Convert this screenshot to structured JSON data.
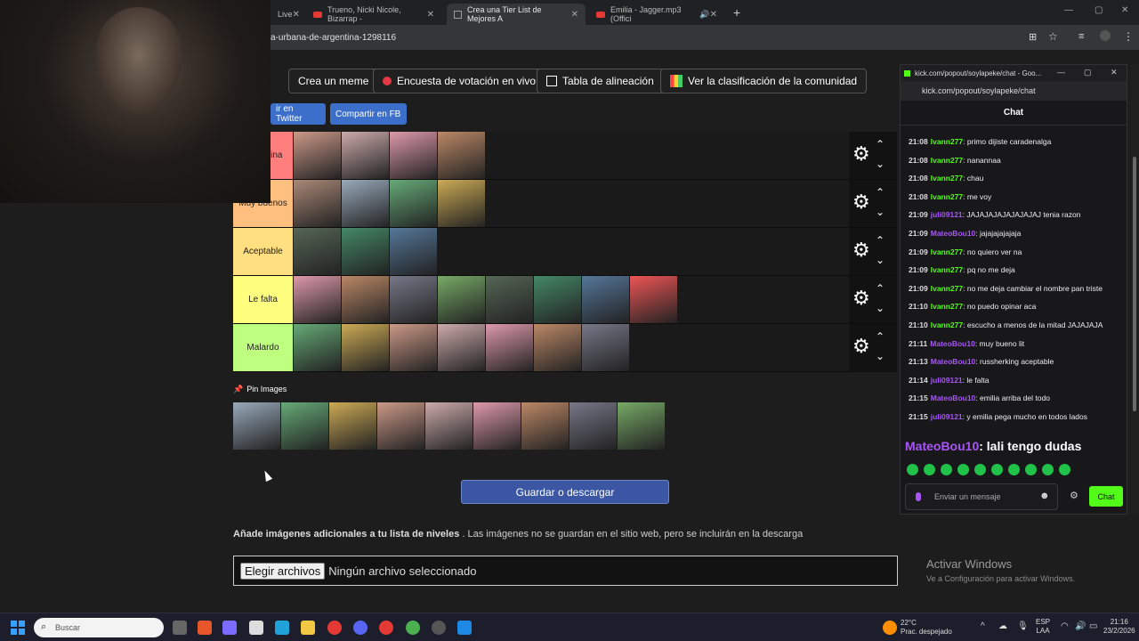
{
  "browser": {
    "tabs": [
      {
        "title": "Live"
      },
      {
        "title": "Trueno, Nicki Nicole, Bizarrap -"
      },
      {
        "title": "Crea una Tier List de Mejores A"
      },
      {
        "title": "Emilia - Jagger.mp3 (Offici"
      }
    ],
    "url": "a-urbana-de-argentina-1298116"
  },
  "toolbar": {
    "meme": "Crea un meme",
    "poll": "Encuesta de votación en vivo",
    "align": "Tabla de alineación",
    "ranking": "Ver la clasificación de la comunidad"
  },
  "share": {
    "twitter": "ir en Twitter",
    "fb": "Compartir en FB"
  },
  "tiers": [
    {
      "label": "ores\nntina",
      "color": "#ff7f7f",
      "count": 4
    },
    {
      "label": "Muy buenos",
      "color": "#ffbf7f",
      "count": 4
    },
    {
      "label": "Aceptable",
      "color": "#ffdf7f",
      "count": 3
    },
    {
      "label": "Le falta",
      "color": "#ffff7f",
      "count": 8
    },
    {
      "label": "Malardo",
      "color": "#bfff7f",
      "count": 7
    }
  ],
  "pin": {
    "label": "Pin Images",
    "count": 9
  },
  "save_button": "Guardar o descargar",
  "add_images": {
    "title": "Añade imágenes adicionales a tu lista de niveles",
    "note": ". Las imágenes no se guardan en el sitio web, pero se incluirán en la descarga"
  },
  "file": {
    "button": "Elegir archivos",
    "status": "Ningún archivo seleccionado"
  },
  "windows_activation": {
    "title": "Activar Windows",
    "subtitle": "Ve a Configuración para activar Windows."
  },
  "chat_popup": {
    "window_title": "kick.com/popout/soylapeke/chat - Goo...",
    "url": "kick.com/popout/soylapeke/chat",
    "header": "Chat",
    "messages": [
      {
        "time": "21:08",
        "user": "Ivann277",
        "text": ": primo dijiste caradenalga",
        "color": "#53fc18"
      },
      {
        "time": "21:08",
        "user": "Ivann277",
        "text": ": nanannaa",
        "color": "#53fc18"
      },
      {
        "time": "21:08",
        "user": "Ivann277",
        "text": ": chau",
        "color": "#53fc18"
      },
      {
        "time": "21:08",
        "user": "Ivann277",
        "text": ": me voy",
        "color": "#53fc18"
      },
      {
        "time": "21:09",
        "user": "juli09121",
        "text": ": JAJAJAJAJAJAJAJAJ tenia razon",
        "color": "#a855f7"
      },
      {
        "time": "21:09",
        "user": "MateoBou10",
        "text": ": jajajajajajaja",
        "color": "#a855f7"
      },
      {
        "time": "21:09",
        "user": "Ivann277",
        "text": ": no quiero ver na",
        "color": "#53fc18"
      },
      {
        "time": "21:09",
        "user": "Ivann277",
        "text": ": pq no me deja",
        "color": "#53fc18"
      },
      {
        "time": "21:09",
        "user": "Ivann277",
        "text": ": no me deja cambiar el nombre pan triste",
        "color": "#53fc18"
      },
      {
        "time": "21:10",
        "user": "Ivann277",
        "text": ": no puedo opinar aca",
        "color": "#53fc18"
      },
      {
        "time": "21:10",
        "user": "Ivann277",
        "text": ": escucho a menos de la mitad JAJAJAJA",
        "color": "#53fc18"
      },
      {
        "time": "21:11",
        "user": "MateoBou10",
        "text": ": muy bueno lit",
        "color": "#a855f7"
      },
      {
        "time": "21:13",
        "user": "MateoBou10",
        "text": ": russherking aceptable",
        "color": "#a855f7"
      },
      {
        "time": "21:14",
        "user": "juli09121",
        "text": ": le falta",
        "color": "#a855f7"
      },
      {
        "time": "21:15",
        "user": "MateoBou10",
        "text": ": emilia arriba del todo",
        "color": "#a855f7"
      },
      {
        "time": "21:15",
        "user": "juli09121",
        "text": ": y emilia pega mucho en todos lados",
        "color": "#a855f7"
      }
    ],
    "highlight": {
      "user": "MateoBou10",
      "text": ": lali tengo dudas"
    },
    "input_placeholder": "Enviar un mensaje",
    "send": "Chat"
  },
  "taskbar": {
    "search": "Buscar",
    "weather_temp": "22°C",
    "weather_desc": "Prac. despejado",
    "lang1": "ESP",
    "lang2": "LAA",
    "time": "21:16",
    "date": "23/2/2026"
  }
}
